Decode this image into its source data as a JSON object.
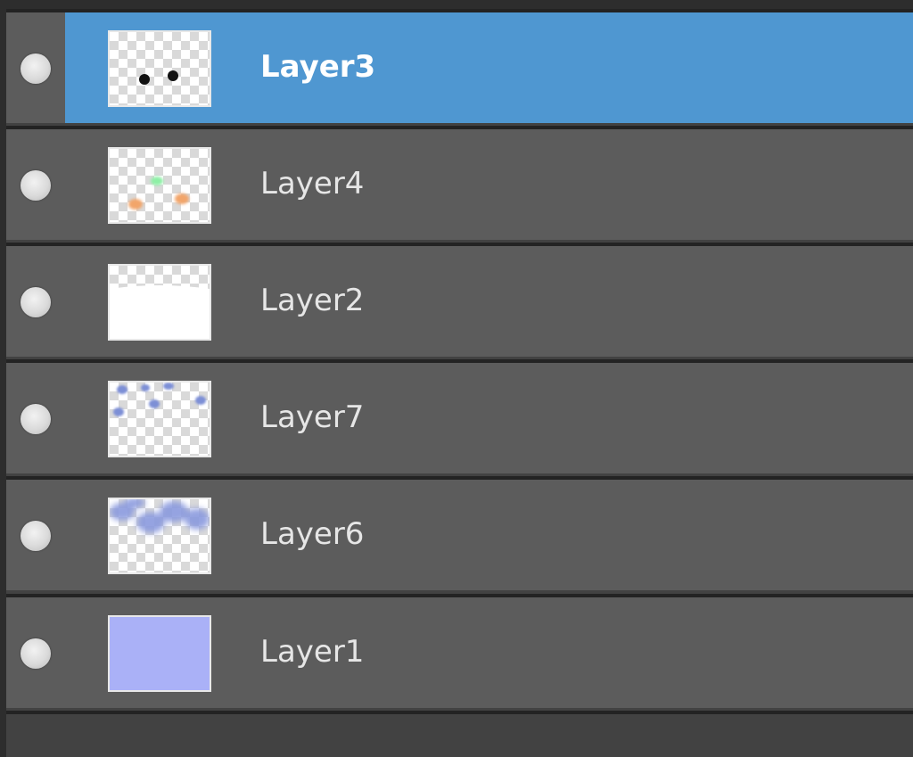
{
  "layers_panel": {
    "layers": [
      {
        "label": "Layer3",
        "selected": true,
        "thumbnail": "two-black-dots"
      },
      {
        "label": "Layer4",
        "selected": false,
        "thumbnail": "green-and-orange-spots"
      },
      {
        "label": "Layer2",
        "selected": false,
        "thumbnail": "white-fill-lower"
      },
      {
        "label": "Layer7",
        "selected": false,
        "thumbnail": "blue-dots"
      },
      {
        "label": "Layer6",
        "selected": false,
        "thumbnail": "blue-blur"
      },
      {
        "label": "Layer1",
        "selected": false,
        "thumbnail": "solid-lavender"
      }
    ],
    "colors": {
      "selected_row": "#4f97d1",
      "row": "#5c5c5c",
      "separator": "#232323",
      "layer1_fill": "#aab1f7"
    },
    "icons": {
      "visibility": "visibility-dot-icon"
    }
  }
}
